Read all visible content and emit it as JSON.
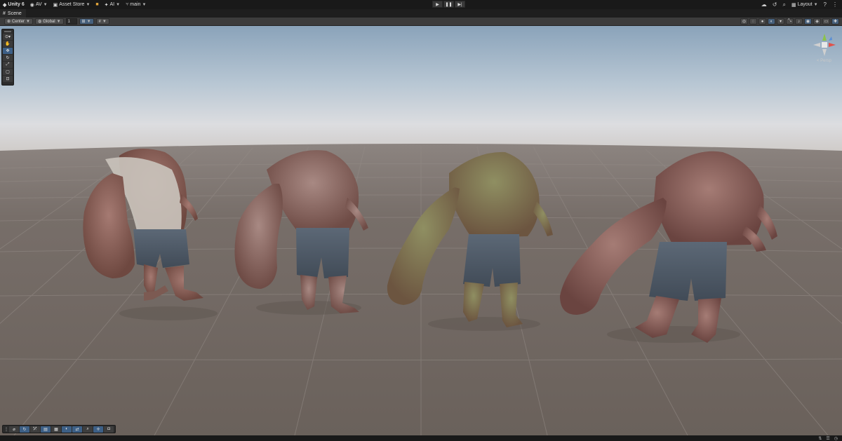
{
  "topbar": {
    "app_name": "Unity 6",
    "account": "AV",
    "asset_store": "Asset Store",
    "ai": "AI",
    "branch": "main",
    "layout": "Layout"
  },
  "play_controls": {
    "play_icon": "play-icon",
    "pause_icon": "pause-icon",
    "step_icon": "step-icon"
  },
  "tabs": [
    {
      "label": "Scene"
    }
  ],
  "scene_toolbar": {
    "pivot_mode": "Center",
    "pivot_rotation": "Global",
    "grid_snap_value": "1"
  },
  "scene_view": {
    "camera_label": "< Persp",
    "gizmo_axes": [
      "y",
      "x",
      "z"
    ],
    "objects": [
      "brute-character-1",
      "brute-character-2",
      "brute-character-3",
      "brute-character-4"
    ]
  },
  "tools": [
    "view-tool",
    "move-tool",
    "rotate-tool",
    "scale-tool",
    "rect-tool",
    "transform-tool"
  ],
  "colors": {
    "accent": "#3c5f86",
    "ground": "#6f6660",
    "sky_top": "#8aa3ba",
    "horizon": "#dcdde0"
  }
}
